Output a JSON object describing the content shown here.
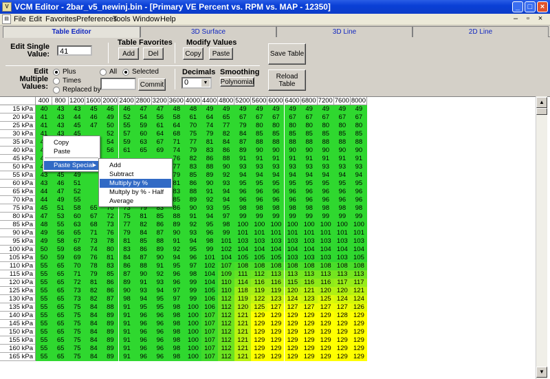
{
  "window": {
    "title": "VCM Editor - 2bar_v5_newinj.bin - [Primary VE Percent vs. RPM vs. MAP - 12350]"
  },
  "menu": [
    "File",
    "Edit",
    "Favorites",
    "Preferences",
    "Tools",
    "Window",
    "Help"
  ],
  "tabs": [
    "Table Editor",
    "3D Surface",
    "3D Line",
    "2D Line"
  ],
  "toolbar": {
    "edit_single_label": "Edit Single Value:",
    "edit_single_value": "41",
    "table_favorites_label": "Table Favorites",
    "add_label": "Add",
    "del_label": "Del",
    "modify_values_label": "Modify Values",
    "copy_label": "Copy",
    "paste_label": "Paste",
    "save_table_label": "Save Table",
    "edit_multiple_label": "Edit Multiple Values:",
    "plus_label": "Plus",
    "times_label": "Times",
    "replaced_by_label": "Replaced by",
    "all_label": "All",
    "selected_label": "Selected",
    "multi_value": "",
    "commit_label": "Commit",
    "decimals_label": "Decimals",
    "decimals_value": "0",
    "smoothing_label": "Smoothing",
    "polynomial_label": "Polynomial",
    "reload_table_label": "Reload Table"
  },
  "context_menu": {
    "items": [
      "Copy",
      "Paste",
      "Paste Special"
    ],
    "submenu": [
      "Add",
      "Subtract",
      "Multiply by %",
      "Multply by % - Half",
      "Average"
    ],
    "highlighted": "Multiply by %"
  },
  "table": {
    "rpm": [
      "400",
      "800",
      "1200",
      "1600",
      "2000",
      "2400",
      "2800",
      "3200",
      "3600",
      "4000",
      "4400",
      "4800",
      "5200",
      "5600",
      "6000",
      "6400",
      "6800",
      "7200",
      "7600",
      "8000"
    ],
    "map": [
      "15 kPa",
      "20 kPa",
      "25 kPa",
      "30 kPa",
      "35 kPa",
      "40 kPa",
      "45 kPa",
      "50 kPa",
      "55 kPa",
      "60 kPa",
      "65 kPa",
      "70 kPa",
      "75 kPa",
      "80 kPa",
      "85 kPa",
      "90 kPa",
      "95 kPa",
      "100 kPa",
      "105 kPa",
      "110 kPa",
      "115 kPa",
      "120 kPa",
      "125 kPa",
      "130 kPa",
      "135 kPa",
      "140 kPa",
      "145 kPa",
      "150 kPa",
      "155 kPa",
      "160 kPa",
      "165 kPa"
    ],
    "rows": [
      [
        40,
        43,
        43,
        45,
        46,
        46,
        47,
        47,
        48,
        48,
        49,
        49,
        49,
        49,
        49,
        49,
        49,
        49,
        49,
        49
      ],
      [
        41,
        43,
        44,
        46,
        49,
        52,
        54,
        56,
        58,
        61,
        64,
        65,
        67,
        67,
        67,
        67,
        67,
        67,
        67,
        67
      ],
      [
        41,
        43,
        45,
        47,
        50,
        55,
        59,
        61,
        64,
        70,
        74,
        77,
        79,
        80,
        80,
        80,
        80,
        80,
        80,
        80
      ],
      [
        41,
        43,
        45,
        "",
        52,
        57,
        60,
        64,
        68,
        75,
        79,
        82,
        84,
        85,
        85,
        85,
        85,
        85,
        85,
        85
      ],
      [
        41,
        43,
        "",
        "",
        54,
        59,
        63,
        67,
        71,
        77,
        81,
        84,
        87,
        88,
        88,
        88,
        88,
        88,
        88,
        88
      ],
      [
        41,
        43,
        "",
        "",
        56,
        61,
        65,
        69,
        74,
        79,
        83,
        86,
        89,
        90,
        90,
        90,
        90,
        90,
        90,
        90
      ],
      [
        41,
        "",
        "",
        "",
        "",
        "",
        "",
        "",
        76,
        82,
        86,
        88,
        91,
        91,
        91,
        91,
        91,
        91,
        91,
        91
      ],
      [
        42,
        "",
        "",
        "",
        "",
        "",
        "",
        "",
        77,
        83,
        88,
        90,
        93,
        93,
        93,
        93,
        93,
        93,
        93,
        93
      ],
      [
        43,
        45,
        49,
        "",
        "",
        "",
        "",
        "",
        79,
        85,
        89,
        92,
        94,
        94,
        94,
        94,
        94,
        94,
        94,
        94
      ],
      [
        43,
        46,
        51,
        "",
        "",
        "",
        "",
        "",
        81,
        86,
        90,
        93,
        95,
        95,
        95,
        95,
        95,
        95,
        95,
        95
      ],
      [
        44,
        47,
        52,
        "",
        "",
        "",
        "",
        "",
        83,
        88,
        91,
        94,
        96,
        96,
        96,
        96,
        96,
        96,
        96,
        96
      ],
      [
        44,
        49,
        55,
        "",
        68,
        71,
        75,
        80,
        85,
        89,
        92,
        94,
        96,
        96,
        96,
        96,
        96,
        96,
        96,
        96
      ],
      [
        45,
        51,
        58,
        65,
        70,
        73,
        79,
        83,
        86,
        90,
        93,
        95,
        98,
        98,
        98,
        98,
        98,
        98,
        98,
        98
      ],
      [
        47,
        53,
        60,
        67,
        72,
        75,
        81,
        85,
        88,
        91,
        94,
        97,
        99,
        99,
        99,
        99,
        99,
        99,
        99,
        99
      ],
      [
        48,
        55,
        63,
        68,
        73,
        77,
        82,
        86,
        89,
        92,
        95,
        98,
        100,
        100,
        100,
        100,
        100,
        100,
        100,
        100
      ],
      [
        49,
        56,
        65,
        71,
        76,
        79,
        84,
        87,
        90,
        93,
        96,
        99,
        101,
        101,
        101,
        101,
        101,
        101,
        101,
        101
      ],
      [
        49,
        58,
        67,
        73,
        78,
        81,
        85,
        88,
        91,
        94,
        98,
        101,
        103,
        103,
        103,
        103,
        103,
        103,
        103,
        103
      ],
      [
        50,
        59,
        68,
        74,
        80,
        83,
        86,
        89,
        92,
        95,
        99,
        102,
        104,
        104,
        104,
        104,
        104,
        104,
        104,
        104
      ],
      [
        50,
        59,
        69,
        76,
        81,
        84,
        87,
        90,
        94,
        96,
        101,
        104,
        105,
        105,
        105,
        103,
        103,
        103,
        103,
        105
      ],
      [
        55,
        65,
        70,
        78,
        83,
        86,
        88,
        91,
        95,
        97,
        102,
        107,
        108,
        108,
        108,
        108,
        108,
        108,
        108,
        108
      ],
      [
        55,
        65,
        71,
        79,
        85,
        87,
        90,
        92,
        96,
        98,
        104,
        109,
        111,
        112,
        113,
        113,
        113,
        113,
        113,
        113
      ],
      [
        55,
        65,
        72,
        81,
        86,
        89,
        91,
        93,
        96,
        99,
        104,
        110,
        114,
        116,
        116,
        115,
        116,
        116,
        117,
        117
      ],
      [
        55,
        65,
        73,
        82,
        86,
        90,
        93,
        94,
        97,
        99,
        105,
        110,
        118,
        119,
        119,
        120,
        121,
        120,
        120,
        121
      ],
      [
        55,
        65,
        73,
        82,
        87,
        98,
        94,
        95,
        97,
        99,
        106,
        112,
        119,
        122,
        123,
        124,
        123,
        125,
        124,
        124
      ],
      [
        55,
        65,
        75,
        84,
        88,
        91,
        95,
        95,
        98,
        100,
        106,
        112,
        120,
        125,
        127,
        127,
        127,
        127,
        127,
        126
      ],
      [
        55,
        65,
        75,
        84,
        89,
        91,
        96,
        96,
        98,
        100,
        107,
        112,
        121,
        129,
        129,
        129,
        129,
        129,
        128,
        129
      ],
      [
        55,
        65,
        75,
        84,
        89,
        91,
        96,
        96,
        98,
        100,
        107,
        112,
        121,
        129,
        129,
        129,
        129,
        129,
        129,
        129
      ],
      [
        55,
        65,
        75,
        84,
        89,
        91,
        96,
        96,
        98,
        100,
        107,
        112,
        121,
        129,
        129,
        129,
        129,
        129,
        129,
        129
      ],
      [
        55,
        65,
        75,
        84,
        89,
        91,
        96,
        96,
        98,
        100,
        107,
        112,
        121,
        129,
        129,
        129,
        129,
        129,
        129,
        129
      ],
      [
        55,
        65,
        75,
        84,
        89,
        91,
        96,
        96,
        98,
        100,
        107,
        112,
        121,
        129,
        129,
        129,
        129,
        129,
        129,
        129
      ],
      [
        55,
        65,
        75,
        84,
        89,
        91,
        96,
        96,
        98,
        100,
        107,
        112,
        121,
        129,
        129,
        129,
        129,
        129,
        129,
        129
      ]
    ]
  },
  "colors": {
    "low": "#2fd82f",
    "high": "#ffff00",
    "select": "#316ac5",
    "title": "#0a3fd6"
  },
  "icons": [
    "app-icon",
    "minimize-icon",
    "maximize-icon",
    "close-icon",
    "scroll-up-icon",
    "scroll-down-icon",
    "submenu-arrow-icon"
  ]
}
